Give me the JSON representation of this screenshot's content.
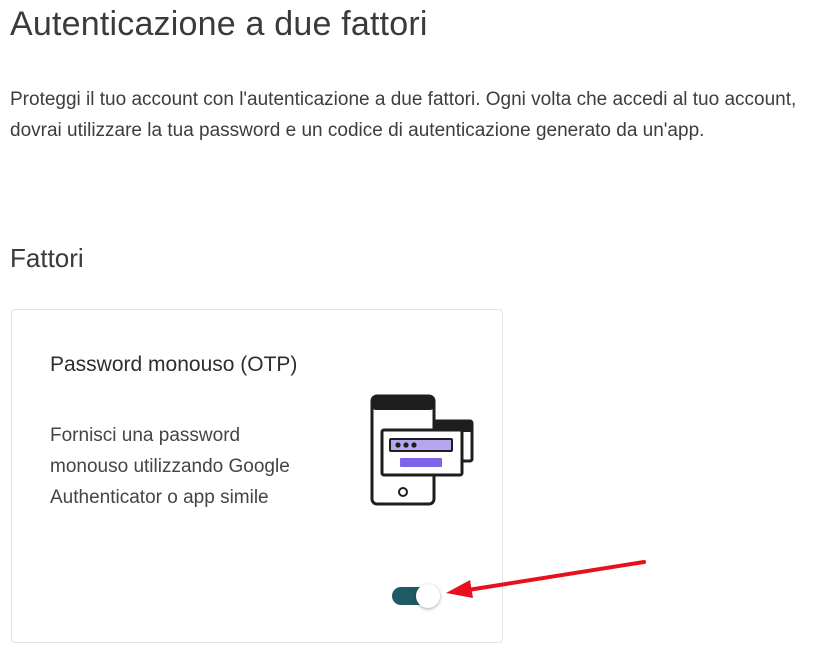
{
  "page": {
    "title": "Autenticazione a due fattori",
    "intro": "Proteggi il tuo account con l'autenticazione a due fattori. Ogni volta che accedi al tuo account, dovrai utilizzare la tua password e un codice di autenticazione generato da un'app."
  },
  "factors": {
    "section_title": "Fattori",
    "items": [
      {
        "title": "Password monouso (OTP)",
        "description": "Fornisci una password monouso utilizzando Google Authenticator o app simile",
        "icon": "phone-otp-illustration",
        "enabled": true
      }
    ]
  },
  "colors": {
    "toggle_on": "#1d5a66",
    "illustration_accent": "#b5a6ef",
    "annotation_arrow": "#e8101c"
  }
}
